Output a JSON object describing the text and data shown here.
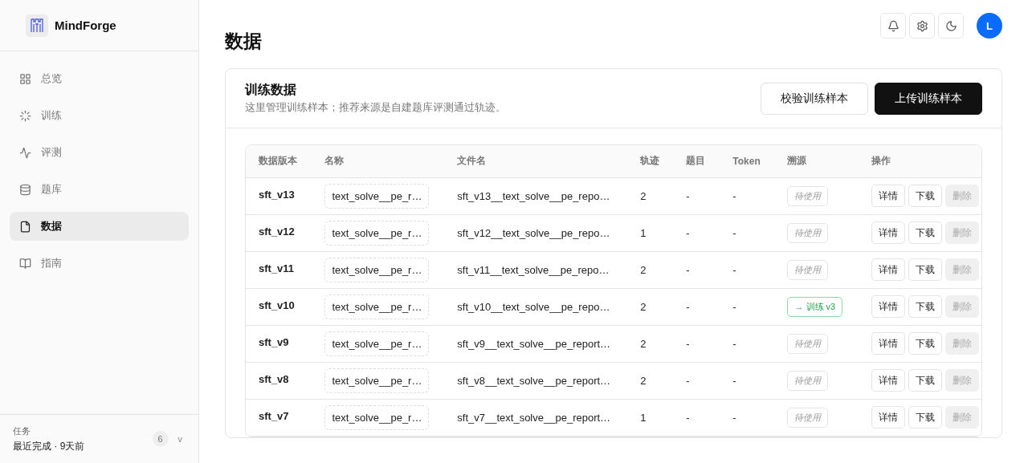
{
  "brand": {
    "name": "MindForge"
  },
  "nav": [
    {
      "label": "总览",
      "selected": false
    },
    {
      "label": "训练",
      "selected": false
    },
    {
      "label": "评测",
      "selected": false
    },
    {
      "label": "题库",
      "selected": false
    },
    {
      "label": "数据",
      "selected": true
    },
    {
      "label": "指南",
      "selected": false
    }
  ],
  "tasks": {
    "title": "任务",
    "status": "最近完成 · 9天前",
    "count": "6",
    "toggle": "v"
  },
  "header": {
    "avatar": "L"
  },
  "page_title": "数据",
  "card": {
    "title": "训练数据",
    "subtitle": "这里管理训练样本；推荐来源是自建题库评测通过轨迹。",
    "buttons": [
      {
        "label": "校验训练样本",
        "kind": "secondary"
      },
      {
        "label": "上传训练样本",
        "kind": "primary"
      }
    ]
  },
  "table": {
    "columns": [
      "数据版本",
      "名称",
      "文件名",
      "轨迹",
      "题目",
      "Token",
      "溯源",
      "操作"
    ],
    "rows": [
      {
        "version": "sft_v13",
        "name": "text_solve__pe_r…",
        "file": "sft_v13__text_solve__pe_repo…",
        "trajectories": "2",
        "questions": "-",
        "tokens": "-",
        "source": {
          "kind": "pending",
          "label": "待使用"
        },
        "actions": [
          {
            "label": "详情",
            "disabled": false
          },
          {
            "label": "下载",
            "disabled": false
          },
          {
            "label": "删除",
            "disabled": true
          }
        ]
      },
      {
        "version": "sft_v12",
        "name": "text_solve__pe_r…",
        "file": "sft_v12__text_solve__pe_repo…",
        "trajectories": "1",
        "questions": "-",
        "tokens": "-",
        "source": {
          "kind": "pending",
          "label": "待使用"
        },
        "actions": [
          {
            "label": "详情",
            "disabled": false
          },
          {
            "label": "下载",
            "disabled": false
          },
          {
            "label": "删除",
            "disabled": true
          }
        ]
      },
      {
        "version": "sft_v11",
        "name": "text_solve__pe_r…",
        "file": "sft_v11__text_solve__pe_repo…",
        "trajectories": "2",
        "questions": "-",
        "tokens": "-",
        "source": {
          "kind": "pending",
          "label": "待使用"
        },
        "actions": [
          {
            "label": "详情",
            "disabled": false
          },
          {
            "label": "下载",
            "disabled": false
          },
          {
            "label": "删除",
            "disabled": true
          }
        ]
      },
      {
        "version": "sft_v10",
        "name": "text_solve__pe_r…",
        "file": "sft_v10__text_solve__pe_repo…",
        "trajectories": "2",
        "questions": "-",
        "tokens": "-",
        "source": {
          "kind": "linked",
          "label": "→ 训练 v3"
        },
        "actions": [
          {
            "label": "详情",
            "disabled": false
          },
          {
            "label": "下载",
            "disabled": false
          },
          {
            "label": "删除",
            "disabled": true
          }
        ]
      },
      {
        "version": "sft_v9",
        "name": "text_solve__pe_r…",
        "file": "sft_v9__text_solve__pe_report…",
        "trajectories": "2",
        "questions": "-",
        "tokens": "-",
        "source": {
          "kind": "pending",
          "label": "待使用"
        },
        "actions": [
          {
            "label": "详情",
            "disabled": false
          },
          {
            "label": "下载",
            "disabled": false
          },
          {
            "label": "删除",
            "disabled": true
          }
        ]
      },
      {
        "version": "sft_v8",
        "name": "text_solve__pe_r…",
        "file": "sft_v8__text_solve__pe_report…",
        "trajectories": "2",
        "questions": "-",
        "tokens": "-",
        "source": {
          "kind": "pending",
          "label": "待使用"
        },
        "actions": [
          {
            "label": "详情",
            "disabled": false
          },
          {
            "label": "下载",
            "disabled": false
          },
          {
            "label": "删除",
            "disabled": true
          }
        ]
      },
      {
        "version": "sft_v7",
        "name": "text_solve__pe_r…",
        "file": "sft_v7__text_solve__pe_report…",
        "trajectories": "1",
        "questions": "-",
        "tokens": "-",
        "source": {
          "kind": "pending",
          "label": "待使用"
        },
        "actions": [
          {
            "label": "详情",
            "disabled": false
          },
          {
            "label": "下载",
            "disabled": false
          },
          {
            "label": "删除",
            "disabled": true
          }
        ]
      }
    ]
  }
}
